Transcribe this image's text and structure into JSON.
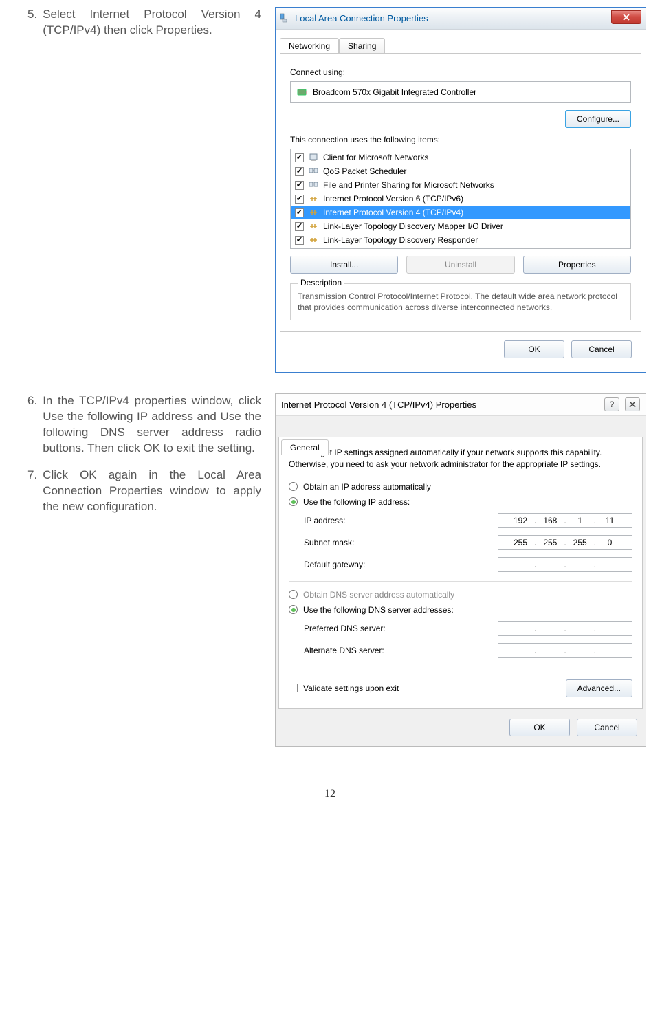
{
  "steps": {
    "5": {
      "num": "5.",
      "text": "Select Internet Protocol Version 4 (TCP/IPv4) then click Properties."
    },
    "6": {
      "num": "6.",
      "text": "In the TCP/IPv4 properties window, click Use the following IP address and Use the following DNS server address radio buttons. Then click OK to exit the setting."
    },
    "7": {
      "num": "7.",
      "text": "Click OK again in the Local Area Connection Properties window to apply the new configuration."
    }
  },
  "dialog1": {
    "title": "Local Area Connection Properties",
    "tab_networking": "Networking",
    "tab_sharing": "Sharing",
    "connect_using": "Connect using:",
    "adapter": "Broadcom 570x Gigabit Integrated Controller",
    "configure": "Configure...",
    "items_label": "This connection uses the following items:",
    "items": [
      "Client for Microsoft Networks",
      "QoS Packet Scheduler",
      "File and Printer Sharing for Microsoft Networks",
      "Internet Protocol Version 6 (TCP/IPv6)",
      "Internet Protocol Version 4 (TCP/IPv4)",
      "Link-Layer Topology Discovery Mapper I/O Driver",
      "Link-Layer Topology Discovery Responder"
    ],
    "install": "Install...",
    "uninstall": "Uninstall",
    "properties": "Properties",
    "desc_label": "Description",
    "desc_text": "Transmission Control Protocol/Internet Protocol. The default wide area network protocol that provides communication across diverse interconnected networks.",
    "ok": "OK",
    "cancel": "Cancel"
  },
  "dialog2": {
    "title": "Internet Protocol Version 4 (TCP/IPv4) Properties",
    "tab_general": "General",
    "intro": "You can get IP settings assigned automatically if your network supports this capability. Otherwise, you need to ask your network administrator for the appropriate IP settings.",
    "opt_ip_auto": "Obtain an IP address automatically",
    "opt_ip_manual": "Use the following IP address:",
    "ip_label": "IP address:",
    "subnet_label": "Subnet mask:",
    "gateway_label": "Default gateway:",
    "ip": {
      "a": "192",
      "b": "168",
      "c": "1",
      "d": "11"
    },
    "subnet": {
      "a": "255",
      "b": "255",
      "c": "255",
      "d": "0"
    },
    "opt_dns_auto": "Obtain DNS server address automatically",
    "opt_dns_manual": "Use the following DNS server addresses:",
    "pref_dns": "Preferred DNS server:",
    "alt_dns": "Alternate DNS server:",
    "validate": "Validate settings upon exit",
    "advanced": "Advanced...",
    "ok": "OK",
    "cancel": "Cancel"
  },
  "page_number": "12"
}
